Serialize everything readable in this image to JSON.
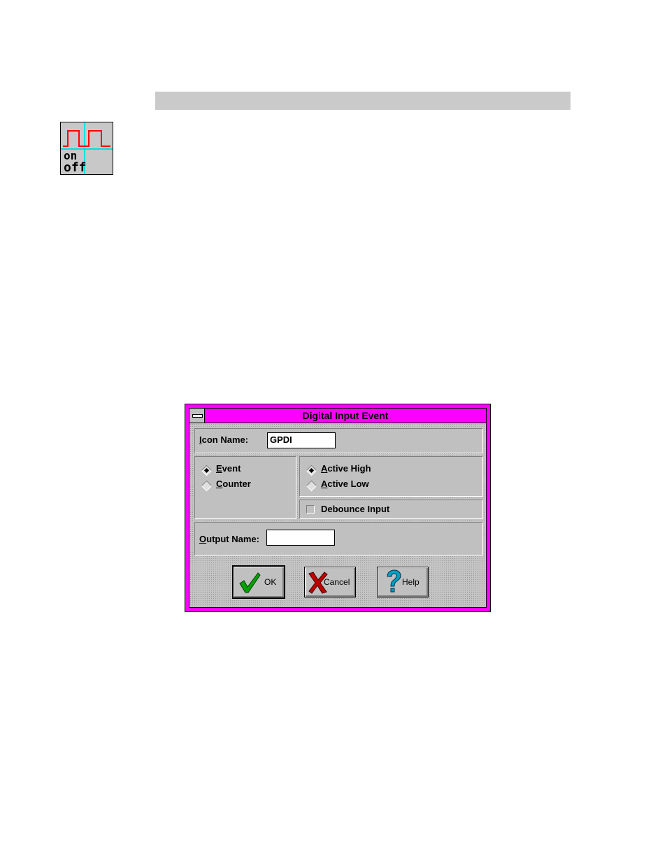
{
  "icon": {
    "top_label": "on",
    "bottom_label": "off"
  },
  "dialog": {
    "title": "Digital Input Event",
    "icon_name_label_first": "I",
    "icon_name_label_rest": "con Name:",
    "icon_name_value": "GPDI",
    "mode_options": [
      {
        "first": "E",
        "rest": "vent",
        "selected": true
      },
      {
        "first": "C",
        "rest": "ounter",
        "selected": false
      }
    ],
    "polarity_options": [
      {
        "first": "A",
        "rest": "ctive High",
        "selected": true
      },
      {
        "first": "A",
        "rest": "ctive Low",
        "selected": false
      }
    ],
    "debounce_label": "Debounce Input",
    "debounce_checked": false,
    "output_name_label_first": "O",
    "output_name_label_rest": "utput Name:",
    "output_name_value": "",
    "buttons": {
      "ok": "OK",
      "cancel": "Cancel",
      "help": "Help"
    }
  },
  "colors": {
    "title_bar": "#ff00ff",
    "signal_red": "#ff0000",
    "signal_cyan": "#00e0e0",
    "ok_green": "#00a000",
    "cancel_red": "#c00000",
    "help_blue": "#00a0c0"
  }
}
